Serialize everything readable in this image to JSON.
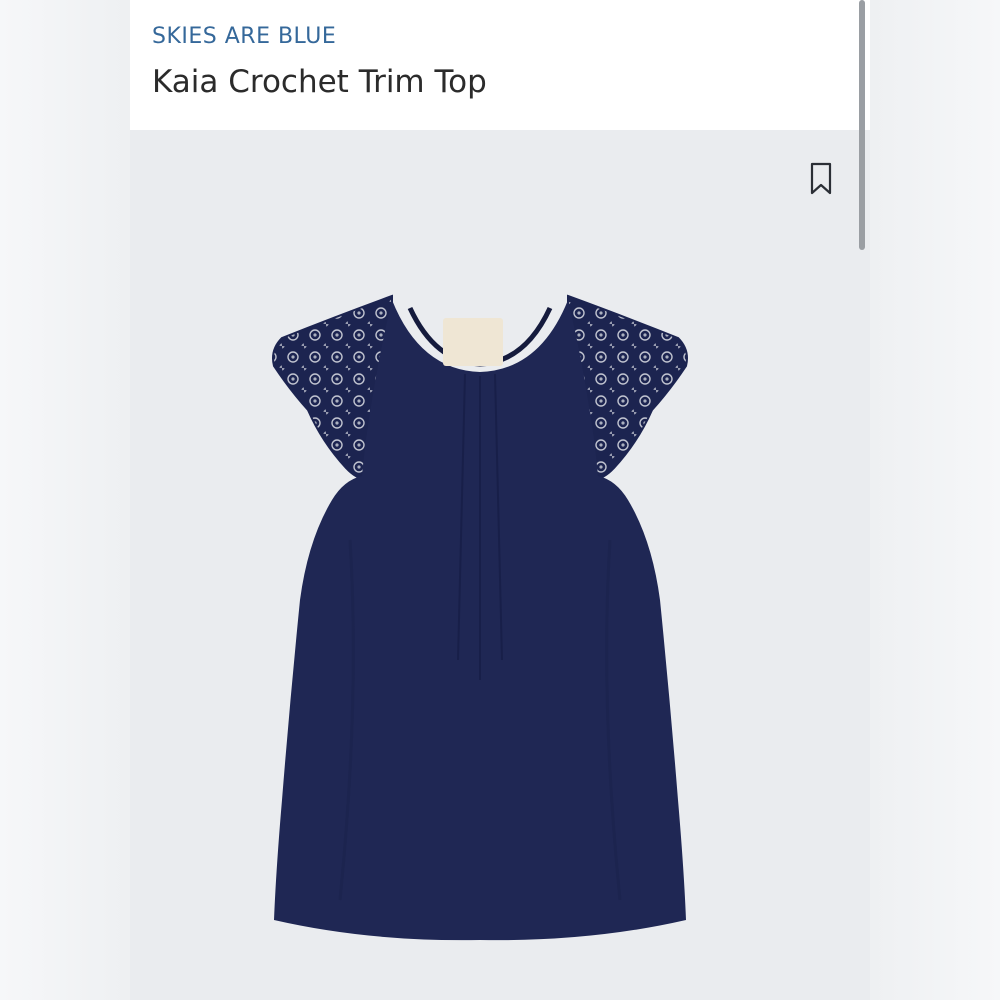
{
  "header": {
    "brand": "SKIES ARE BLUE",
    "product_title": "Kaia Crochet Trim Top"
  },
  "actions": {
    "bookmark_icon": "bookmark-icon"
  },
  "product": {
    "garment_color": "#1f2754",
    "image_background": "#eaecef"
  },
  "colors": {
    "brand_accent": "#35689a",
    "title_text": "#2b2b2b"
  }
}
